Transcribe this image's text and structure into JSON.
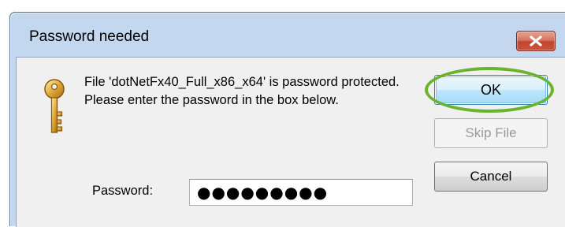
{
  "dialog": {
    "title": "Password needed",
    "close_label": "",
    "message": "File 'dotNetFx40_Full_x86_x64' is password protected.  Please enter the password in the box below.",
    "icon": "key-icon"
  },
  "buttons": {
    "ok_label": "OK",
    "skip_label": "Skip File",
    "skip_enabled": false,
    "cancel_label": "Cancel"
  },
  "password": {
    "label": "Password:",
    "masked_value": "●●●●●●●●●"
  },
  "annotation": {
    "highlight": "ok-button",
    "color": "#6ab42d"
  },
  "colors": {
    "frame": "#c3d7ee",
    "client": "#f0f0f0",
    "close": "#c9553d"
  }
}
